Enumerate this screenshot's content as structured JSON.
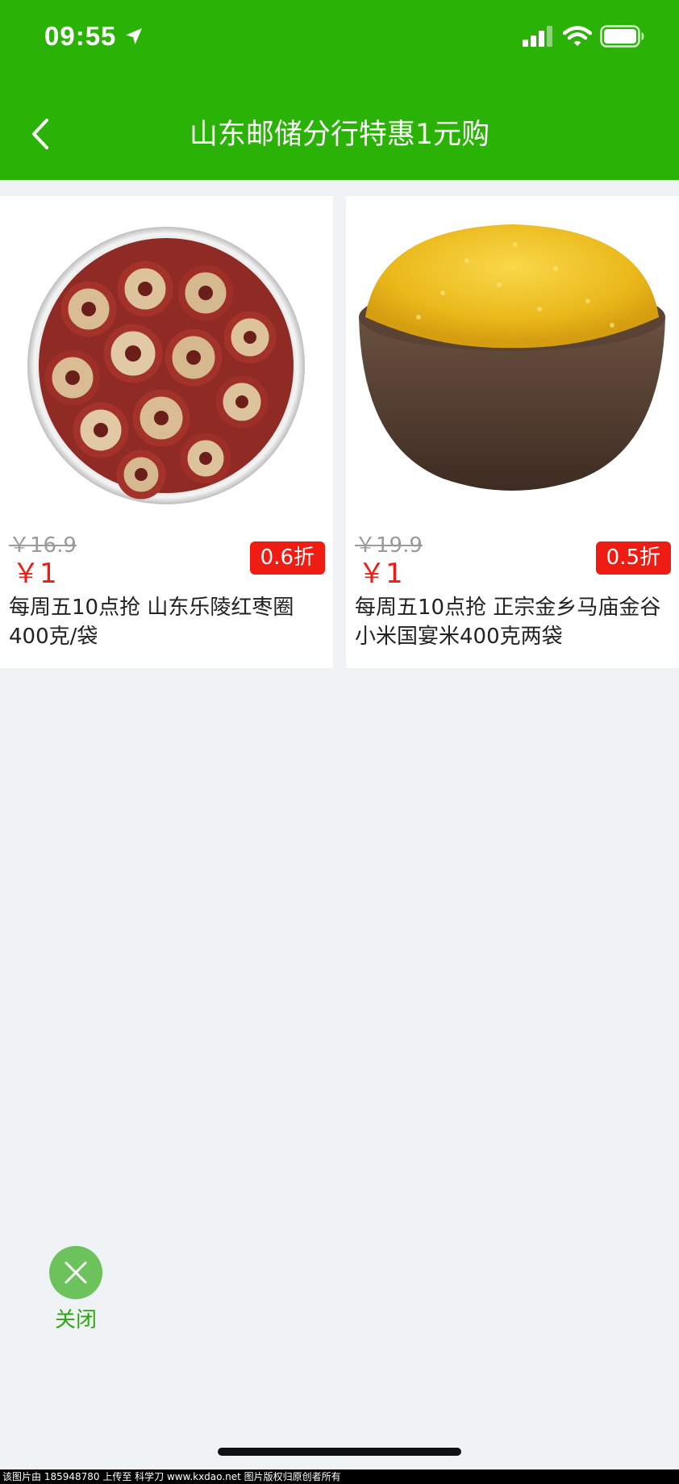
{
  "status_bar": {
    "time": "09:55",
    "icons": [
      "location-arrow-icon",
      "signal-icon",
      "wifi-icon",
      "battery-icon"
    ]
  },
  "nav": {
    "back_icon": "chevron-left-icon",
    "title": "山东邮储分行特惠1元购"
  },
  "products": [
    {
      "image": "red-date-rings-in-tin",
      "old_price": "￥16.9",
      "price": "￥1",
      "discount": "0.6折",
      "name": "每周五10点抢 山东乐陵红枣圈400克/袋"
    },
    {
      "image": "millet-in-clay-bowl",
      "old_price": "￥19.9",
      "price": "￥1",
      "discount": "0.5折",
      "name": "每周五10点抢 正宗金乡马庙金谷小米国宴米400克两袋"
    }
  ],
  "close": {
    "icon": "close-x-icon",
    "label": "关闭"
  },
  "watermark": "该图片由 185948780 上传至 科学刀 www.kxdao.net 图片版权归原创者所有",
  "colors": {
    "header": "#2bb206",
    "price_red": "#ee1c12",
    "close_green": "#6cc35b",
    "background": "#eff3f5"
  }
}
